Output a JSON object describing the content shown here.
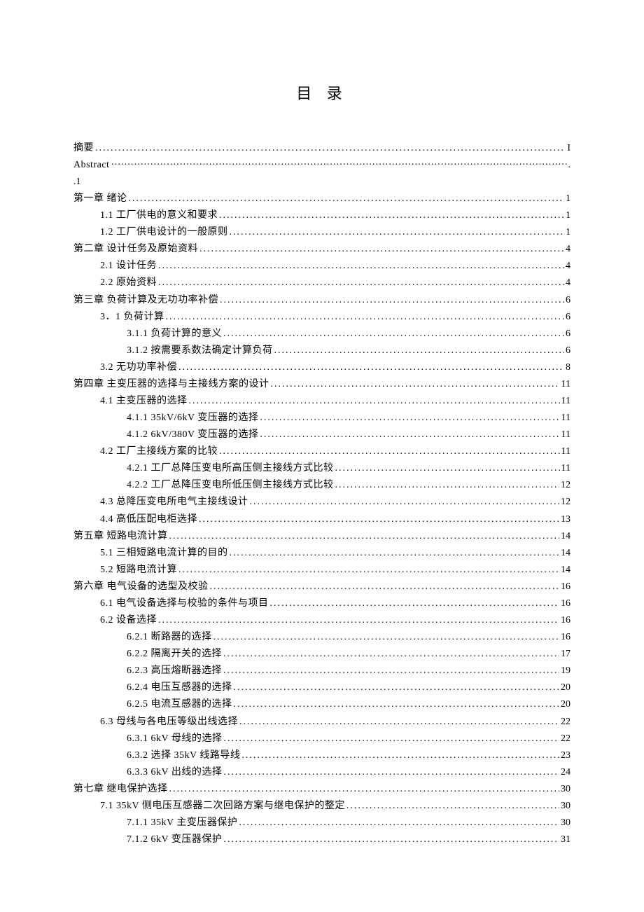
{
  "title": "目 录",
  "entries": [
    {
      "level": 0,
      "label": "摘要",
      "page": "I",
      "dots": "std"
    },
    {
      "level": 0,
      "label": "Abstract",
      "page": ".",
      "dots": "mid"
    },
    {
      "level": 0,
      "label": ".1",
      "page": "",
      "dots": "none"
    },
    {
      "level": 0,
      "label": "第一章 绪论",
      "page": "1",
      "dots": "std"
    },
    {
      "level": 1,
      "label": "1.1 工厂供电的意义和要求 ",
      "page": "1",
      "dots": "std"
    },
    {
      "level": 1,
      "label": "1.2 工厂供电设计的一般原则 ",
      "page": "1",
      "dots": "std"
    },
    {
      "level": 0,
      "label": "第二章 设计任务及原始资料",
      "page": "4",
      "dots": "std"
    },
    {
      "level": 1,
      "label": "2.1 设计任务",
      "page": "4",
      "dots": "std"
    },
    {
      "level": 1,
      "label": "2.2 原始资料",
      "page": "4",
      "dots": "std"
    },
    {
      "level": 0,
      "label": "第三章 负荷计算及无功功率补偿",
      "page": "6",
      "dots": "std"
    },
    {
      "level": 1,
      "label": "3．1 负荷计算 ",
      "page": "6",
      "dots": "std"
    },
    {
      "level": 2,
      "label": "3.1.1  负荷计算的意义",
      "page": "6",
      "dots": "std"
    },
    {
      "level": 2,
      "label": "3.1.2  按需要系数法确定计算负荷",
      "page": "6",
      "dots": "std"
    },
    {
      "level": 1,
      "label": "3.2 无功功率补偿",
      "page": "8",
      "dots": "std"
    },
    {
      "level": 0,
      "label": "第四章 主变压器的选择与主接线方案的设计",
      "page": "11",
      "dots": "std"
    },
    {
      "level": 1,
      "label": "4.1  主变压器的选择",
      "page": "11",
      "dots": "std"
    },
    {
      "level": 2,
      "label": "4.1.1  35kV/6kV 变压器的选择 ",
      "page": "11",
      "dots": "std"
    },
    {
      "level": 2,
      "label": "4.1.2  6kV/380V 变压器的选择 ",
      "page": "11",
      "dots": "std"
    },
    {
      "level": 1,
      "label": "4.2  工厂主接线方案的比较",
      "page": "11",
      "dots": "std"
    },
    {
      "level": 2,
      "label": "4.2.1  工厂总降压变电所高压侧主接线方式比较",
      "page": "11",
      "dots": "std"
    },
    {
      "level": 2,
      "label": "4.2.2  工厂总降压变电所低压侧主接线方式比较",
      "page": "12",
      "dots": "std"
    },
    {
      "level": 1,
      "label": "4.3 总降压变电所电气主接线设计",
      "page": "12",
      "dots": "std"
    },
    {
      "level": 1,
      "label": "4.4  高低压配电柜选择",
      "page": "13",
      "dots": "std"
    },
    {
      "level": 0,
      "label": "第五章 短路电流计算",
      "page": "14",
      "dots": "std"
    },
    {
      "level": 1,
      "label": "5.1 三相短路电流计算的目的",
      "page": "14",
      "dots": "std"
    },
    {
      "level": 1,
      "label": "5.2 短路电流计算",
      "page": "14",
      "dots": "std"
    },
    {
      "level": 0,
      "label": "第六章 电气设备的选型及校验",
      "page": "16",
      "dots": "std"
    },
    {
      "level": 1,
      "label": "6.1  电气设备选择与校验的条件与项目",
      "page": "16",
      "dots": "std"
    },
    {
      "level": 1,
      "label": "6.2  设备选择",
      "page": "16",
      "dots": "std"
    },
    {
      "level": 2,
      "label": "6.2.1  断路器的选择",
      "page": "16",
      "dots": "std"
    },
    {
      "level": 2,
      "label": "6.2.2  隔离开关的选择",
      "page": "17",
      "dots": "std"
    },
    {
      "level": 2,
      "label": "6.2.3  高压熔断器选择",
      "page": "19",
      "dots": "std"
    },
    {
      "level": 2,
      "label": "6.2.4  电压互感器的选择",
      "page": "20",
      "dots": "std"
    },
    {
      "level": 2,
      "label": "6.2.5  电流互感器的选择",
      "page": "20",
      "dots": "std"
    },
    {
      "level": 1,
      "label": "6.3  母线与各电压等级出线选择",
      "page": "22",
      "dots": "std"
    },
    {
      "level": 2,
      "label": "6.3.1  6kV 母线的选择 ",
      "page": "22",
      "dots": "std"
    },
    {
      "level": 2,
      "label": "6.3.2  选择 35kV 线路导线",
      "page": "23",
      "dots": "std"
    },
    {
      "level": 2,
      "label": "6.3.3  6kV 出线的选择 ",
      "page": "24",
      "dots": "std"
    },
    {
      "level": 0,
      "label": "第七章  继电保护选择",
      "page": "30",
      "dots": "std"
    },
    {
      "level": 1,
      "label": "7.1  35kV 侧电压互感器二次回路方案与继电保护的整定 ",
      "page": "30",
      "dots": "std"
    },
    {
      "level": 2,
      "label": "7.1.1  35kV 主变压器保护 ",
      "page": "30",
      "dots": "std"
    },
    {
      "level": 2,
      "label": "7.1.2  6kV 变压器保护 ",
      "page": "31",
      "dots": "std"
    }
  ]
}
